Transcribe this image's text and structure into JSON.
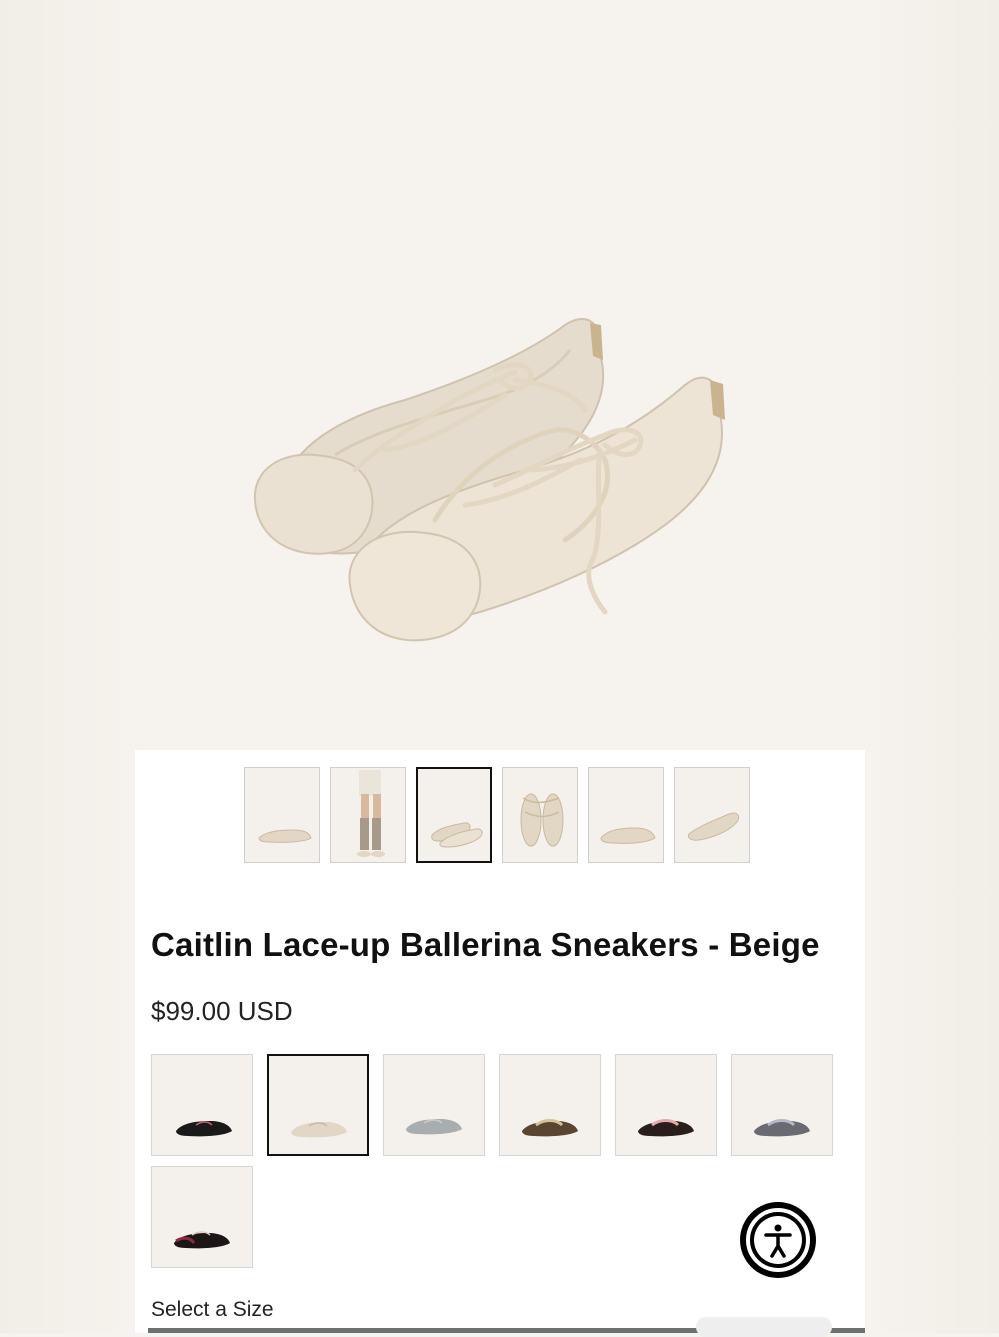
{
  "product": {
    "title": "Caitlin Lace-up Ballerina Sneakers - Beige",
    "price": "$99.00 USD"
  },
  "gallery": {
    "thumbnail_count": 6,
    "active_index": 2
  },
  "color_swatches": {
    "selected_index": 1,
    "colors": [
      "#1a1a1a",
      "#e2d6c4",
      "#a8adb0",
      "#5a4530",
      "#2a1e1c",
      "#6a6a72",
      "#1c1616"
    ],
    "accent_colors": [
      "#d05a6a",
      "#cbb99f",
      "#c9cdd0",
      "#d6c29a",
      "#e8a8a8",
      "#b7b7c9",
      "#8c2a44"
    ]
  },
  "size_section": {
    "label": "Select a Size"
  },
  "accessibility": {
    "icon": "accessibility-icon"
  }
}
